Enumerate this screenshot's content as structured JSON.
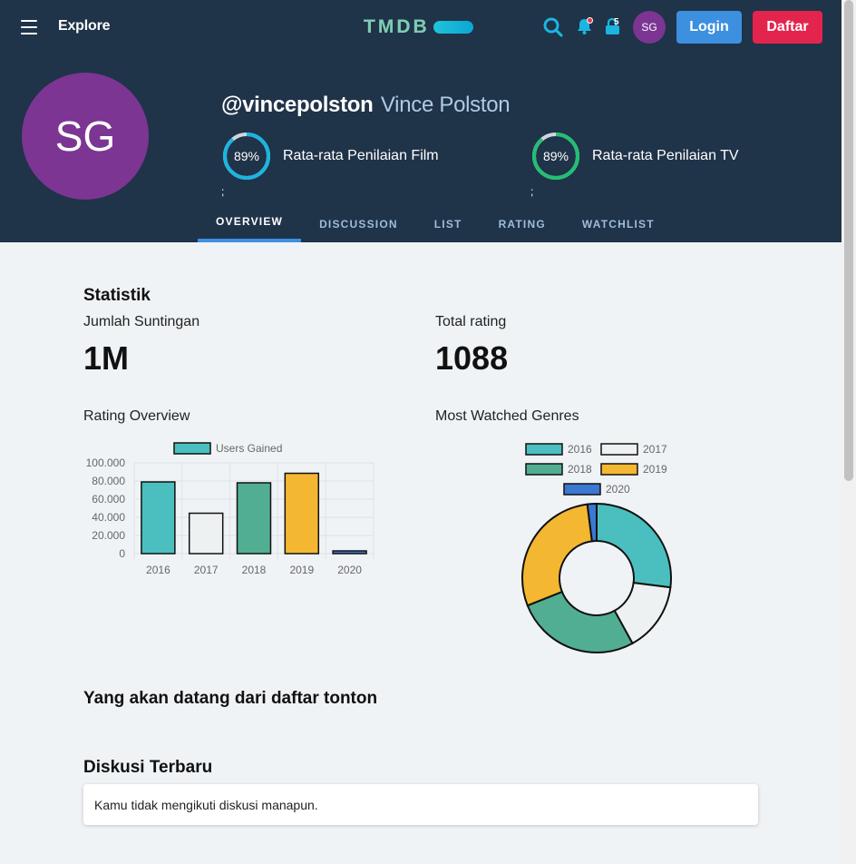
{
  "nav": {
    "explore_label": "Explore",
    "logo_text": "TMDB",
    "notification_count": "5",
    "avatar_initials": "SG",
    "login_label": "Login",
    "signup_label": "Daftar"
  },
  "profile": {
    "avatar_initials": "SG",
    "username": "@vincepolston",
    "real_name": "Vince Polston",
    "film_score": "89%",
    "film_score_fraction": 0.89,
    "film_score_label": "Rata-rata Penilaian Film",
    "tv_score": "89%",
    "tv_score_fraction": 0.89,
    "tv_score_label": "Rata-rata Penilaian TV",
    "stray_char": ";"
  },
  "tabs": [
    {
      "label": "OVERVIEW",
      "active": true
    },
    {
      "label": "DISCUSSION",
      "active": false
    },
    {
      "label": "LIST",
      "active": false
    },
    {
      "label": "RATING",
      "active": false
    },
    {
      "label": "WATCHLIST",
      "active": false
    }
  ],
  "stats": {
    "heading": "Statistik",
    "edits_label": "Jumlah Suntingan",
    "edits_value": "1M",
    "ratings_label": "Total rating",
    "ratings_value": "1088"
  },
  "colors": {
    "c2016": "#4bbfbf",
    "c2017": "#eef1f2",
    "c2018": "#52ae92",
    "c2019": "#f3b731",
    "c2020": "#3a78d2",
    "film_ring": "#1bb5e0",
    "tv_ring": "#21c072"
  },
  "chart_data": [
    {
      "type": "bar",
      "title": "Rating Overview",
      "categories": [
        "2016",
        "2017",
        "2018",
        "2019",
        "2020"
      ],
      "series": [
        {
          "name": "Users Gained",
          "values": [
            79000,
            44500,
            78000,
            88500,
            3000
          ]
        }
      ],
      "ylim": [
        0,
        100000
      ],
      "yticks": [
        "100.000",
        "80.000",
        "60.000",
        "40.000",
        "20.000",
        "0"
      ],
      "legend": "top",
      "grid": true
    },
    {
      "type": "pie",
      "title": "Most Watched Genres",
      "labels": [
        "2016",
        "2017",
        "2018",
        "2019",
        "2020"
      ],
      "values": [
        27,
        15,
        27,
        29,
        2
      ],
      "donut": true,
      "legend": "top"
    }
  ],
  "sections": {
    "upcoming_heading": "Yang akan datang dari daftar tonton",
    "discussion_heading": "Diskusi Terbaru",
    "discussion_empty": "Kamu tidak mengikuti diskusi manapun."
  }
}
